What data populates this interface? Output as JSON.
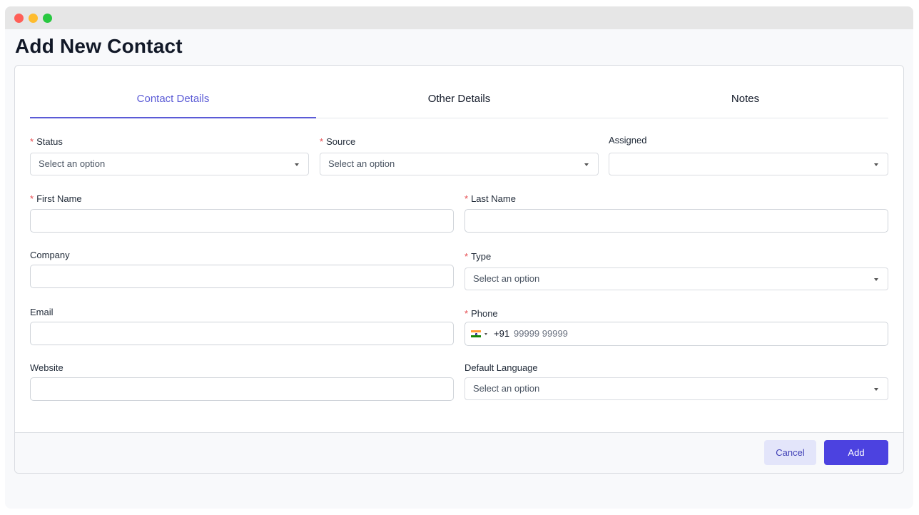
{
  "window": {
    "controls": [
      "close",
      "minimize",
      "maximize"
    ]
  },
  "page_title": "Add New Contact",
  "tabs": [
    {
      "label": "Contact Details",
      "active": true
    },
    {
      "label": "Other Details",
      "active": false
    },
    {
      "label": "Notes",
      "active": false
    }
  ],
  "form": {
    "status": {
      "label": "Status",
      "required": true,
      "placeholder": "Select an option"
    },
    "source": {
      "label": "Source",
      "required": true,
      "placeholder": "Select an option"
    },
    "assigned": {
      "label": "Assigned",
      "required": false,
      "value": ""
    },
    "first_name": {
      "label": "First Name",
      "required": true,
      "value": ""
    },
    "last_name": {
      "label": "Last Name",
      "required": true,
      "value": ""
    },
    "company": {
      "label": "Company",
      "required": false,
      "value": ""
    },
    "type": {
      "label": "Type",
      "required": true,
      "placeholder": "Select an option"
    },
    "email": {
      "label": "Email",
      "required": false,
      "value": ""
    },
    "phone": {
      "label": "Phone",
      "required": true,
      "dial_code": "+91",
      "placeholder": "99999 99999",
      "flag": "india-flag-icon"
    },
    "website": {
      "label": "Website",
      "required": false,
      "value": ""
    },
    "default_language": {
      "label": "Default Language",
      "required": false,
      "placeholder": "Select an option"
    }
  },
  "footer": {
    "cancel_label": "Cancel",
    "add_label": "Add"
  },
  "colors": {
    "accent": "#5b5bd6",
    "primary_button": "#4c42e0",
    "required": "#e5484d"
  }
}
